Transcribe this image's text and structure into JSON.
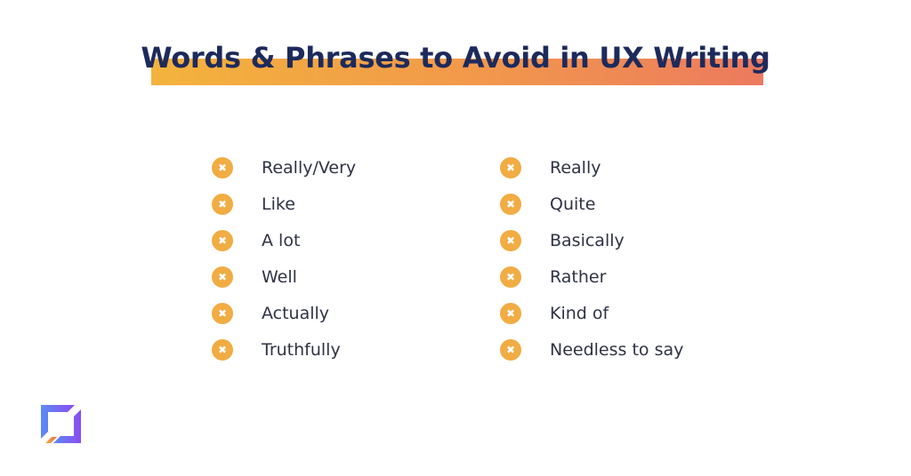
{
  "title": "Words & Phrases to Avoid in UX Writing",
  "colors": {
    "title": "#1d2a5c",
    "accent_start": "#f3b33c",
    "accent_end": "#ec7a5e",
    "icon": "#f1ac43",
    "text": "#2f3245"
  },
  "left_list": [
    {
      "icon": "x-circle-icon",
      "label": "Really/Very"
    },
    {
      "icon": "x-circle-icon",
      "label": "Like"
    },
    {
      "icon": "x-circle-icon",
      "label": "A lot"
    },
    {
      "icon": "x-circle-icon",
      "label": "Well"
    },
    {
      "icon": "x-circle-icon",
      "label": "Actually"
    },
    {
      "icon": "x-circle-icon",
      "label": "Truthfully"
    }
  ],
  "right_list": [
    {
      "icon": "x-circle-icon",
      "label": "Really"
    },
    {
      "icon": "x-circle-icon",
      "label": "Quite"
    },
    {
      "icon": "x-circle-icon",
      "label": "Basically"
    },
    {
      "icon": "x-circle-icon",
      "label": "Rather"
    },
    {
      "icon": "x-circle-icon",
      "label": "Kind of"
    },
    {
      "icon": "x-circle-icon",
      "label": "Needless to say"
    }
  ],
  "icon_glyph": "✖"
}
